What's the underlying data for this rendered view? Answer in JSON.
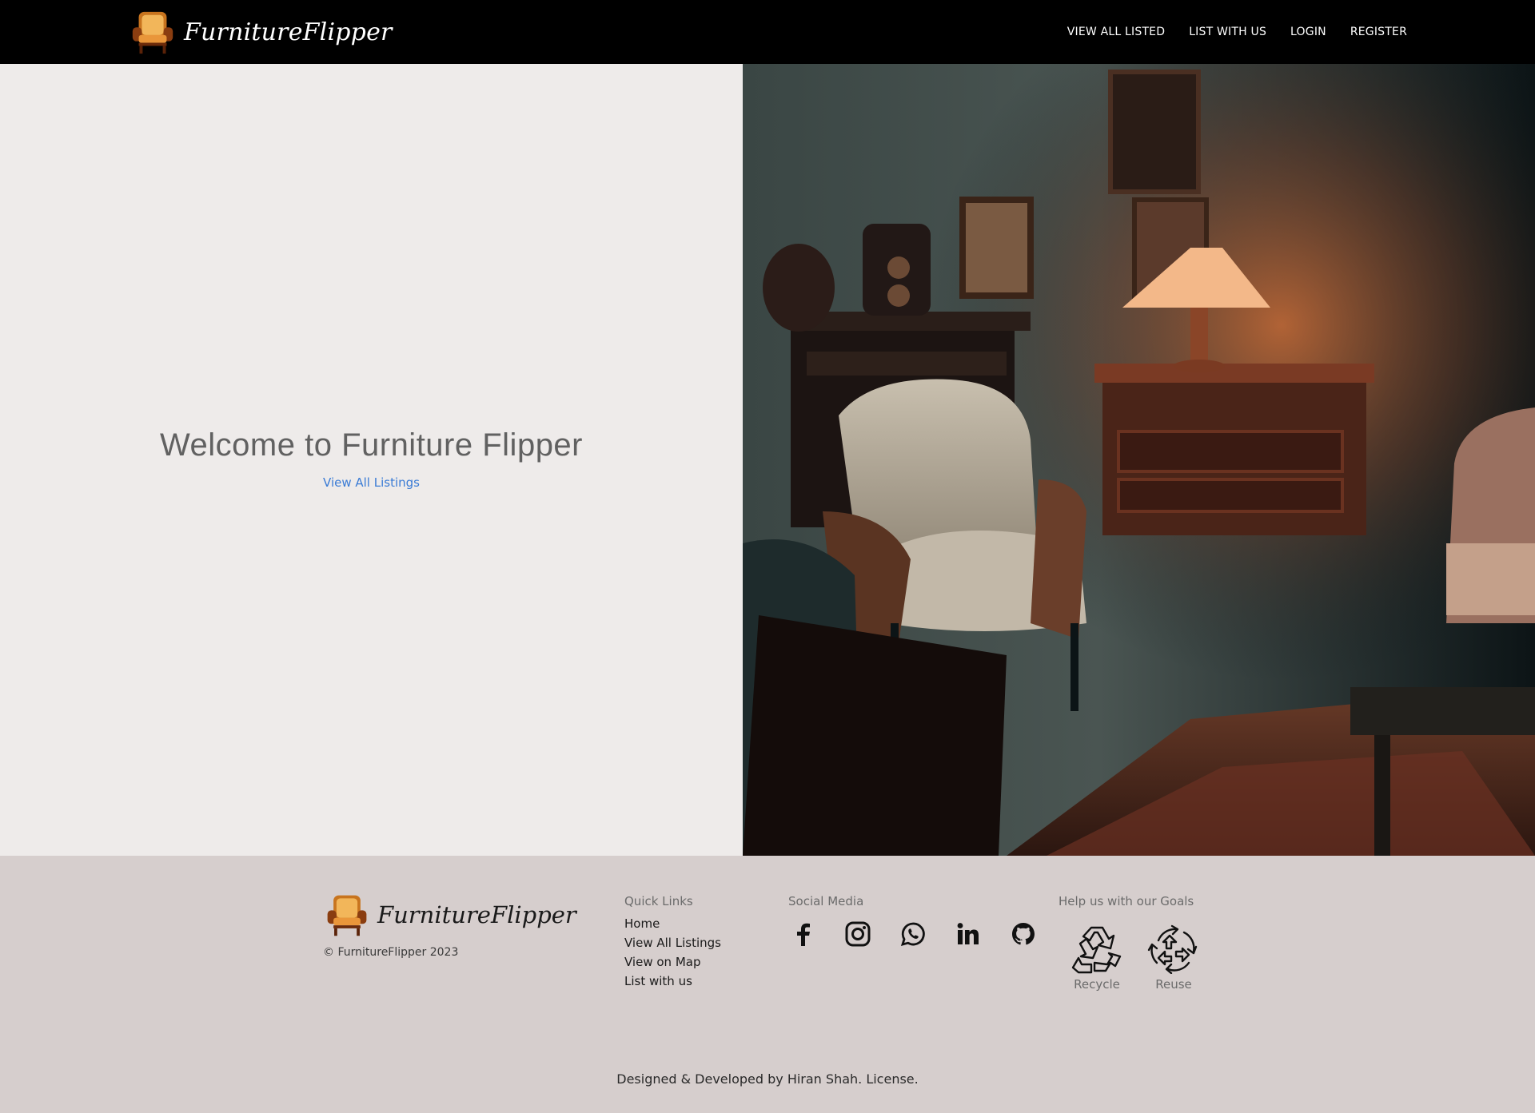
{
  "navbar": {
    "brand": "FurnitureFlipper",
    "links": [
      "VIEW ALL LISTED",
      "LIST WITH US",
      "LOGIN",
      "REGISTER"
    ]
  },
  "hero": {
    "title": "Welcome to Furniture Flipper",
    "cta": "View All Listings",
    "image_icon": "vintage-furniture-photo"
  },
  "footer": {
    "brand": "FurnitureFlipper",
    "copyright": "© FurnitureFlipper 2023",
    "quick_links": {
      "title": "Quick Links",
      "items": [
        "Home",
        "View All Listings",
        "View on Map",
        "List with us"
      ]
    },
    "social": {
      "title": "Social Media",
      "icons": [
        "facebook-icon",
        "instagram-icon",
        "whatsapp-icon",
        "linkedin-icon",
        "github-icon"
      ]
    },
    "goals": {
      "title": "Help us with our Goals",
      "items": [
        "Recycle",
        "Reuse"
      ]
    },
    "credits": "Designed & Developed by Hiran Shah. License."
  },
  "colors": {
    "navbar_bg": "#000000",
    "hero_left_bg": "#eeebea",
    "footer_bg": "#d6cecd",
    "link": "#3a7bd5",
    "title_gray": "#616161"
  }
}
